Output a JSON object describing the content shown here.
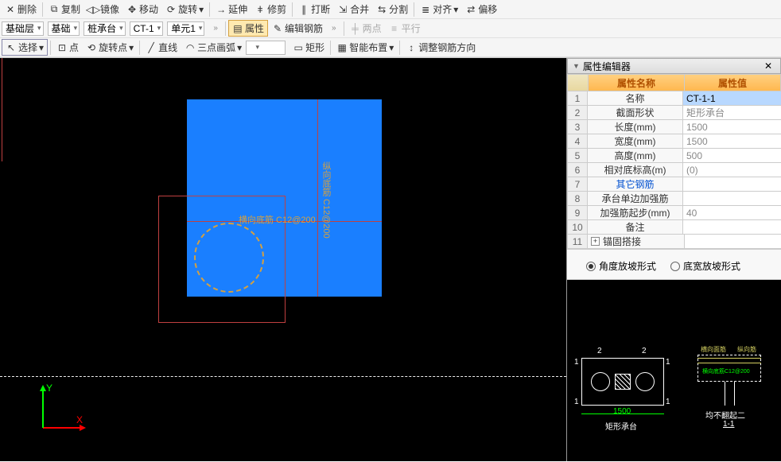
{
  "toolbar1": {
    "delete": "删除",
    "copy": "复制",
    "mirror": "镜像",
    "move": "移动",
    "rotate": "旋转",
    "extend": "延伸",
    "trim": "修剪",
    "break": "打断",
    "merge": "合并",
    "split": "分割",
    "align": "对齐",
    "offset": "偏移"
  },
  "toolbar2": {
    "layer": "基础层",
    "foundation": "基础",
    "pilecap": "桩承台",
    "ct1": "CT-1",
    "unit1": "单元1",
    "prop": "属性",
    "editrebar": "编辑钢筋",
    "twopt": "两点",
    "parallel": "平行"
  },
  "toolbar3": {
    "select": "选择",
    "point": "点",
    "rotpoint": "旋转点",
    "line": "直线",
    "arc3pt": "三点画弧",
    "rect": "矩形",
    "smartlayout": "智能布置",
    "adjustrebar": "调整钢筋方向"
  },
  "panel": {
    "title": "属性编辑器",
    "h_name": "属性名称",
    "h_val": "属性值"
  },
  "rows": [
    {
      "n": "1",
      "name": "名称",
      "val": "CT-1-1",
      "sel": true
    },
    {
      "n": "2",
      "name": "截面形状",
      "val": "矩形承台"
    },
    {
      "n": "3",
      "name": "长度(mm)",
      "val": "1500"
    },
    {
      "n": "4",
      "name": "宽度(mm)",
      "val": "1500"
    },
    {
      "n": "5",
      "name": "高度(mm)",
      "val": "500"
    },
    {
      "n": "6",
      "name": "相对底标高(m)",
      "val": "(0)"
    },
    {
      "n": "7",
      "name": "其它钢筋",
      "val": "",
      "blue": true
    },
    {
      "n": "8",
      "name": "承台单边加强筋",
      "val": ""
    },
    {
      "n": "9",
      "name": "加强筋起步(mm)",
      "val": "40"
    },
    {
      "n": "10",
      "name": "备注",
      "val": ""
    },
    {
      "n": "11",
      "name": "锚固搭接",
      "val": "",
      "tree": true
    }
  ],
  "radio": {
    "opt1": "角度放坡形式",
    "opt2": "底宽放坡形式"
  },
  "canvas": {
    "label_h": "横向底筋 C12@200",
    "label_v": "纵向底筋 C12@200",
    "axis_x": "X",
    "axis_y": "Y"
  },
  "preview": {
    "cap_left": "矩形承台",
    "dim_l": "1500",
    "cap_right": "均不翻起二",
    "sec": "1-1",
    "rebar": "横向底筋C12@200"
  }
}
